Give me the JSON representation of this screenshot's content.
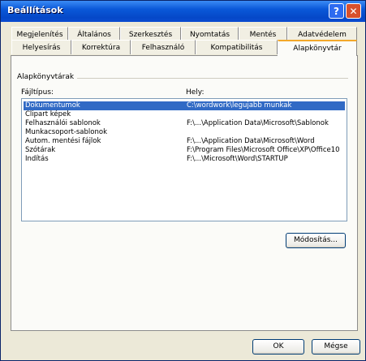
{
  "window": {
    "title": "Beállítások"
  },
  "titlebar": {
    "help_glyph": "?",
    "close_glyph": "✕"
  },
  "tabs_row1": [
    "Megjelenítés",
    "Általános",
    "Szerkesztés",
    "Nyomtatás",
    "Mentés",
    "Adatvédelem"
  ],
  "tabs_row2": [
    "Helyesírás",
    "Korrektúra",
    "Felhasználó",
    "Kompatibilitás",
    "Alapkönyvtár"
  ],
  "active_tab": "Alapkönyvtár",
  "group": {
    "label": "Alapkönyvtárak"
  },
  "columns": {
    "type": "Fájltípus:",
    "location": "Hely:"
  },
  "rows": [
    {
      "type": "Dokumentumok",
      "location": "C:\\wordwork\\legujabb munkak",
      "selected": true
    },
    {
      "type": "Clipart képek",
      "location": ""
    },
    {
      "type": "Felhasználói sablonok",
      "location": "F:\\...\\Application Data\\Microsoft\\Sablonok"
    },
    {
      "type": "Munkacsoport-sablonok",
      "location": ""
    },
    {
      "type": "Autom. mentési fájlok",
      "location": "F:\\...\\Application Data\\Microsoft\\Word"
    },
    {
      "type": "Szótárak",
      "location": "F:\\Program Files\\Microsoft Office\\XP\\Office10"
    },
    {
      "type": "Indítás",
      "location": "F:\\...\\Microsoft\\Word\\STARTUP"
    }
  ],
  "buttons": {
    "modify": "Módosítás...",
    "ok": "OK",
    "cancel": "Mégse"
  },
  "colors": {
    "title_bar": "#0a58d8",
    "selection": "#316ac5",
    "active_tab_accent": "#f3a82a",
    "dialog_bg": "#ece9d8"
  }
}
